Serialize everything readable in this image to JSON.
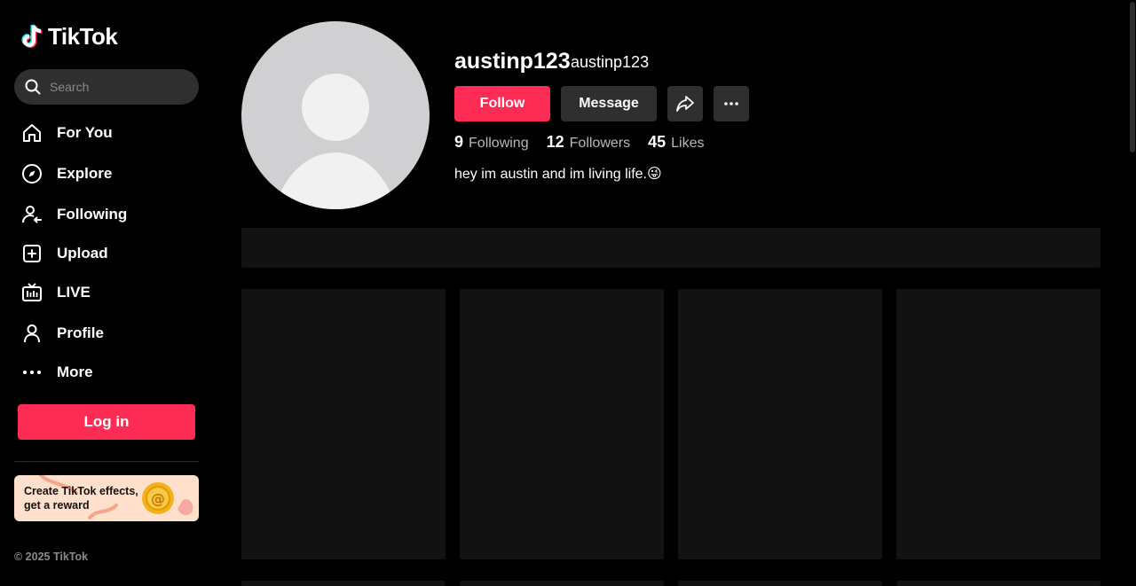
{
  "brand": {
    "name": "TikTok"
  },
  "search": {
    "placeholder": "Search"
  },
  "nav": {
    "items": [
      {
        "label": "For You",
        "icon": "home-icon"
      },
      {
        "label": "Explore",
        "icon": "compass-icon"
      },
      {
        "label": "Following",
        "icon": "following-icon"
      },
      {
        "label": "Upload",
        "icon": "upload-icon"
      },
      {
        "label": "LIVE",
        "icon": "live-icon"
      },
      {
        "label": "Profile",
        "icon": "profile-icon"
      },
      {
        "label": "More",
        "icon": "more-icon"
      }
    ]
  },
  "login": {
    "label": "Log in"
  },
  "promo": {
    "text": "Create TikTok effects, get a reward"
  },
  "footer": {
    "copyright": "© 2025 TikTok"
  },
  "profile": {
    "username": "austinp123",
    "nickname": "austinp123",
    "bio": "hey im austin and im living life.😜",
    "stats": {
      "following": {
        "num": "9",
        "label": "Following"
      },
      "followers": {
        "num": "12",
        "label": "Followers"
      },
      "likes": {
        "num": "45",
        "label": "Likes"
      }
    }
  },
  "actions": {
    "follow": "Follow",
    "message": "Message"
  },
  "colors": {
    "accent": "#fe2c55",
    "background": "#000000",
    "surface": "#2f2f2f",
    "placeholder_tile": "#121212"
  }
}
